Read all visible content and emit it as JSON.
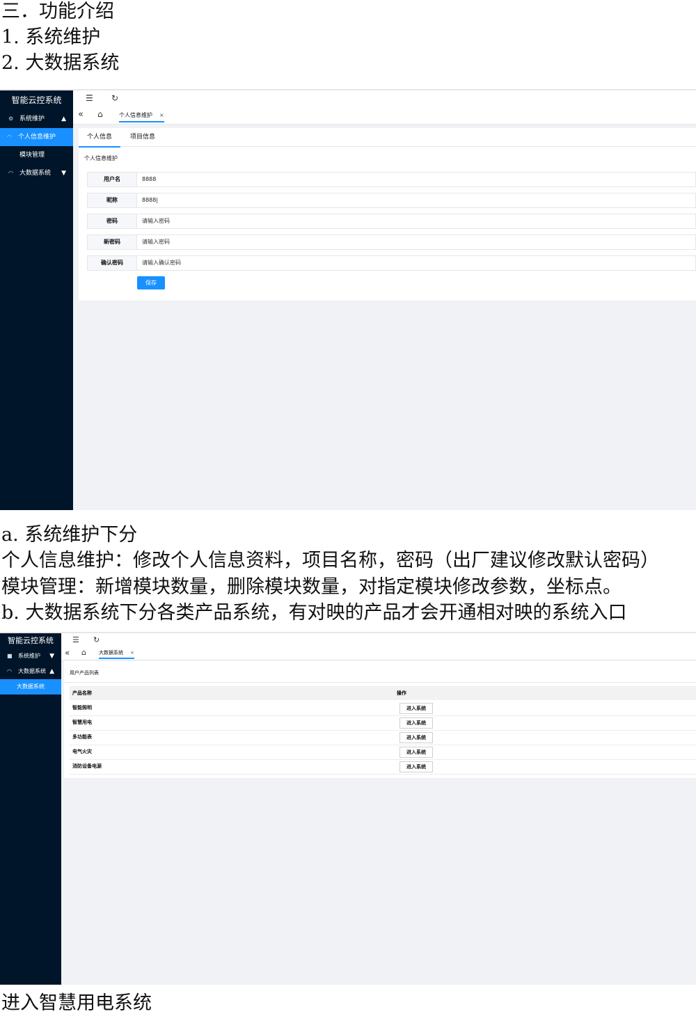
{
  "doc": {
    "heading_functions": "三．功能介绍",
    "item1": "1. 系统维护",
    "item2": "2. 大数据系统",
    "para_a_title": "a. 系统维护下分",
    "para_a_line1": "个人信息维护：修改个人信息资料，项目名称，密码（出厂建议修改默认密码）",
    "para_a_line2": "模块管理：新增模块数量，删除模块数量，对指定模块修改参数，坐标点。",
    "para_b": "b. 大数据系统下分各类产品系统，有对映的产品才会开通相对映的系统入口",
    "footer": "进入智慧用电系统"
  },
  "shot1": {
    "app_title": "智能云控系统",
    "menu": {
      "system": "系统维护",
      "personal": "个人信息维护",
      "module": "模块管理",
      "bigdata": "大数据系统"
    },
    "tab": {
      "label": "个人信息维护",
      "close": "×"
    },
    "subtabs": [
      "个人信息",
      "项目信息"
    ],
    "section_title": "个人信息维护",
    "form": {
      "username_label": "用户名",
      "username_value": "8888",
      "nickname_label": "昵称",
      "nickname_value": "8888|",
      "password_label": "密码",
      "password_placeholder": "请输入密码",
      "newpassword_label": "新密码",
      "newpassword_placeholder": "请输入密码",
      "confirm_label": "确认密码",
      "confirm_placeholder": "请输入确认密码"
    },
    "save_label": "保存"
  },
  "shot2": {
    "app_title": "智能云控系统",
    "menu": {
      "system": "系统维护",
      "bigdata": "大数据系统",
      "bigdata_sub": "大数据系统"
    },
    "tab": {
      "label": "大数据系统",
      "close": "×"
    },
    "section_title": "用户产品列表",
    "columns": [
      "产品名称",
      "操作"
    ],
    "rows": [
      {
        "name": "智能照明",
        "action": "进入系统"
      },
      {
        "name": "智慧用电",
        "action": "进入系统"
      },
      {
        "name": "多功能表",
        "action": "进入系统"
      },
      {
        "name": "电气火灾",
        "action": "进入系统"
      },
      {
        "name": "消防设备电源",
        "action": "进入系统"
      }
    ]
  },
  "colors": {
    "sidebar": "#001529",
    "accent": "#1890ff",
    "content_bg": "#f0f2f5"
  }
}
